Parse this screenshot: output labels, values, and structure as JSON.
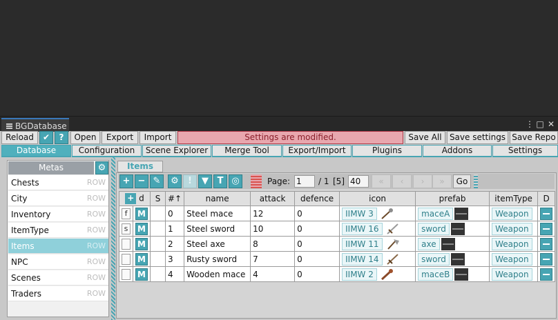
{
  "window": {
    "title": "BGDatabase",
    "menu_glyph": "⋮",
    "restore_glyph": "□",
    "close_glyph": "✕"
  },
  "toolbar": {
    "reload": "Reload",
    "check_glyph": "✔",
    "help_glyph": "?",
    "open": "Open",
    "export": "Export",
    "import": "Import",
    "warning": "Settings are modified.",
    "save_all": "Save All",
    "save_settings": "Save settings",
    "save_repo": "Save Repo"
  },
  "tabs": [
    "Database",
    "Configuration",
    "Scene Explorer",
    "Merge Tool",
    "Export/Import",
    "Plugins",
    "Addons",
    "Settings"
  ],
  "metas": {
    "header": "Metas",
    "gear_glyph": "⚙",
    "items": [
      {
        "name": "Chests",
        "badge": "ROW"
      },
      {
        "name": "City",
        "badge": "ROW"
      },
      {
        "name": "Inventory",
        "badge": "ROW"
      },
      {
        "name": "ItemType",
        "badge": "ROW"
      },
      {
        "name": "Items",
        "badge": "ROW"
      },
      {
        "name": "NPC",
        "badge": "ROW"
      },
      {
        "name": "Scenes",
        "badge": "ROW"
      },
      {
        "name": "Traders",
        "badge": "ROW"
      }
    ]
  },
  "items_view": {
    "tab": "Items",
    "controls": {
      "add": "+",
      "remove": "−",
      "edit": "✎",
      "settings": "⚙",
      "alert": "!",
      "filter": "▼",
      "paint": "T",
      "target": "◎"
    },
    "pager": {
      "page_label": "Page:",
      "page": "1",
      "of": "/ 1",
      "count": "[5]",
      "page_size": "40",
      "first": "«",
      "prev": "‹",
      "next": "›",
      "last": "»",
      "go": "Go"
    },
    "columns": {
      "add": "+",
      "id": "d",
      "s": "S",
      "index": "#↑",
      "name": "name",
      "attack": "attack",
      "defence": "defence",
      "icon": "icon",
      "prefab": "prefab",
      "itemType": "itemType",
      "d": "D"
    },
    "rows": [
      {
        "flag": "f",
        "m": "M",
        "index": "0",
        "name": "Steel mace",
        "attack": "12",
        "defence": "0",
        "icon": "IIMW 3",
        "prefab": "maceA",
        "itemType": "Weapon"
      },
      {
        "flag": "s",
        "m": "M",
        "index": "1",
        "name": "Steel sword",
        "attack": "10",
        "defence": "0",
        "icon": "IIMW 16",
        "prefab": "sword",
        "itemType": "Weapon"
      },
      {
        "flag": "",
        "m": "M",
        "index": "2",
        "name": "Steel axe",
        "attack": "8",
        "defence": "0",
        "icon": "IIMW 11",
        "prefab": "axe",
        "itemType": "Weapon"
      },
      {
        "flag": "",
        "m": "M",
        "index": "3",
        "name": "Rusty sword",
        "attack": "7",
        "defence": "0",
        "icon": "IIMW 14",
        "prefab": "sword",
        "itemType": "Weapon"
      },
      {
        "flag": "",
        "m": "M",
        "index": "4",
        "name": "Wooden mace",
        "attack": "4",
        "defence": "0",
        "icon": "IIMW 2",
        "prefab": "maceB",
        "itemType": "Weapon"
      }
    ]
  },
  "colors": {
    "accent": "#47a5b3",
    "selected": "#8fd0da",
    "warning_bg": "#e8a7ae",
    "warning_text": "#8a1f2b"
  }
}
